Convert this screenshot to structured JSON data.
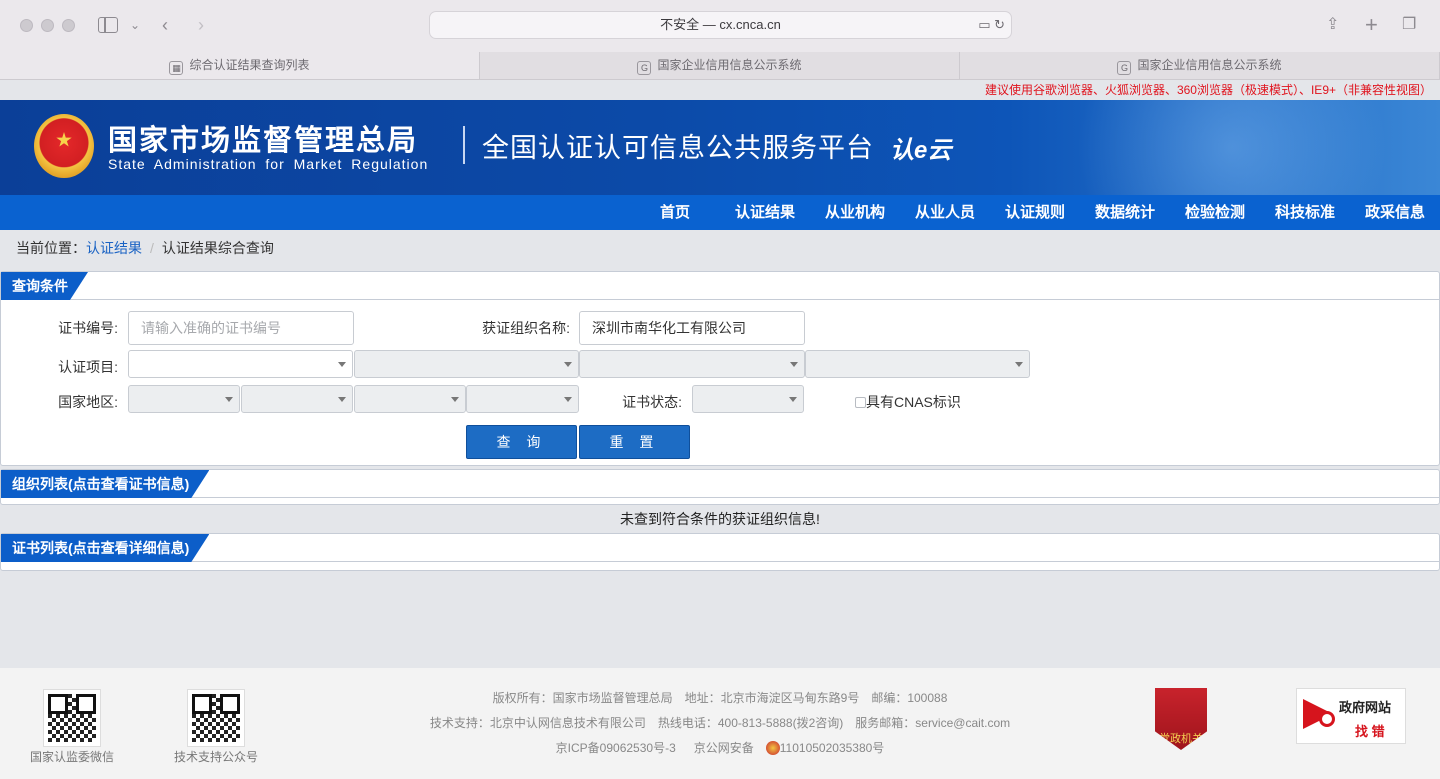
{
  "browser": {
    "url": "不安全 — cx.cnca.cn",
    "tabs": [
      "综合认证结果查询列表",
      "国家企业信用信息公示系统",
      "国家企业信用信息公示系统"
    ]
  },
  "notice": "建议使用谷歌浏览器、火狐浏览器、360浏览器（极速模式）、IE9+（非兼容性视图）",
  "header": {
    "title_cn": "国家市场监督管理总局",
    "title_en": "State Administration for Market Regulation",
    "platform": "全国认证认可信息公共服务平台",
    "logo_text": "认e云"
  },
  "nav": [
    "首页",
    "认证结果",
    "从业机构",
    "从业人员",
    "认证规则",
    "数据统计",
    "检验检测",
    "科技标准",
    "政采信息"
  ],
  "breadcrumb": {
    "prefix": "当前位置：",
    "link": "认证结果",
    "current": "认证结果综合查询"
  },
  "query": {
    "title": "查询条件",
    "cert_no_label": "证书编号:",
    "cert_no_placeholder": "请输入准确的证书编号",
    "org_label": "获证组织名称:",
    "org_value": "深圳市南华化工有限公司",
    "project_label": "认证项目:",
    "region_label": "国家地区:",
    "status_label": "证书状态:",
    "cnas_label": "具有CNAS标识",
    "search_button": "查 询",
    "reset_button": "重 置"
  },
  "org_list": {
    "title": "组织列表(点击查看证书信息)",
    "empty": "未查到符合条件的获证组织信息!"
  },
  "cert_list": {
    "title": "证书列表(点击查看详细信息)"
  },
  "footer": {
    "qr1": "国家认监委微信",
    "qr2": "技术支持公众号",
    "line1": [
      "版权所有：国家市场监督管理总局",
      "地址：北京市海淀区马甸东路9号",
      "邮编：100088"
    ],
    "line2": [
      "技术支持：北京中认网信息技术有限公司",
      "热线电话：400-813-5888(拨2咨询)",
      "服务邮箱：service@cait.com"
    ],
    "line3": [
      "京ICP备09062530号-3",
      "京公网安备",
      "11010502035380号"
    ],
    "party_badge": "党政机关",
    "gov_t1": "政府网站",
    "gov_t2": "找 错"
  }
}
